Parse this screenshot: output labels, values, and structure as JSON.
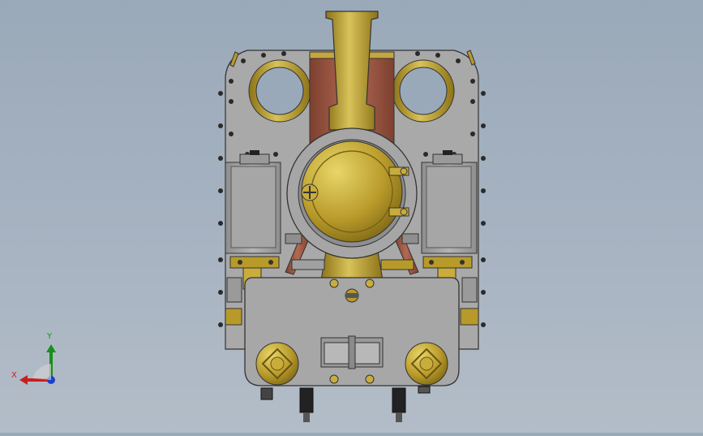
{
  "viewport": {
    "background_top": "#9aa9b9",
    "background_bottom": "#b3bdc8"
  },
  "model": {
    "view": "front",
    "colors": {
      "steel": "#a8a8a8",
      "steel_dark": "#6e6e6e",
      "brass": "#b89a2a",
      "brass_light": "#d8c25a",
      "copper": "#a8604a"
    }
  },
  "triad": {
    "x_label": "X",
    "y_label": "Y",
    "x_color": "#c81e1e",
    "y_color": "#1a8f1a",
    "z_color": "#1e3fc8"
  }
}
